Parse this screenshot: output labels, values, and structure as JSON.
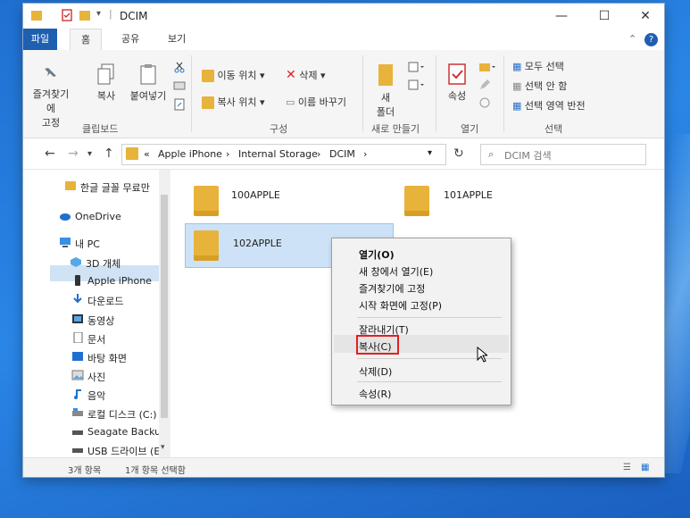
{
  "window": {
    "title": "DCIM",
    "minimize": "—",
    "maximize": "☐",
    "close": "✕"
  },
  "ribbon_tabs": [
    {
      "label": "파일"
    },
    {
      "label": "홈"
    },
    {
      "label": "공유"
    },
    {
      "label": "보기"
    }
  ],
  "ribbon": {
    "clipboard": {
      "pin_line1": "즐겨찾기에",
      "pin_line2": "고정",
      "copy": "복사",
      "paste": "붙여넣기",
      "group": "클립보드"
    },
    "organize": {
      "move_to": "이동 위치",
      "copy_to": "복사 위치",
      "delete": "삭제",
      "rename": "이름 바꾸기",
      "group": "구성"
    },
    "new": {
      "new_folder_line1": "새",
      "new_folder_line2": "폴더",
      "group": "새로 만들기"
    },
    "open": {
      "properties": "속성",
      "group": "열기"
    },
    "select": {
      "select_all": "모두 선택",
      "select_none": "선택 안 함",
      "invert": "선택 영역 반전",
      "group": "선택"
    }
  },
  "address": {
    "prefix": "«",
    "crumbs": [
      "Apple iPhone",
      "Internal Storage",
      "DCIM"
    ],
    "separator": "›",
    "search_placeholder": "DCIM 검색"
  },
  "nav_pane": [
    {
      "label": "한글 글꼴 무료만",
      "icon": "folder-icon"
    },
    {
      "label": "OneDrive",
      "icon": "cloud-icon"
    },
    {
      "label": "내 PC",
      "icon": "pc-icon"
    },
    {
      "label": "3D 개체",
      "icon": "cube-icon"
    },
    {
      "label": "Apple iPhone",
      "icon": "phone-icon"
    },
    {
      "label": "다운로드",
      "icon": "download-icon"
    },
    {
      "label": "동영상",
      "icon": "video-icon"
    },
    {
      "label": "문서",
      "icon": "document-icon"
    },
    {
      "label": "바탕 화면",
      "icon": "desktop-icon"
    },
    {
      "label": "사진",
      "icon": "picture-icon"
    },
    {
      "label": "음악",
      "icon": "music-icon"
    },
    {
      "label": "로컬 디스크 (C:)",
      "icon": "disk-icon"
    },
    {
      "label": "Seagate Backup",
      "icon": "drive-icon"
    },
    {
      "label": "USB 드라이브 (E",
      "icon": "usb-icon"
    }
  ],
  "files": [
    {
      "name": "100APPLE"
    },
    {
      "name": "101APPLE"
    },
    {
      "name": "102APPLE"
    }
  ],
  "context_menu": {
    "open": "열기(O)",
    "open_new_window": "새 창에서 열기(E)",
    "pin_quick": "즐겨찾기에 고정",
    "pin_start": "시작 화면에 고정(P)",
    "cut": "잘라내기(T)",
    "copy": "복사(C)",
    "delete": "삭제(D)",
    "properties": "속성(R)"
  },
  "status": {
    "count": "3개 항목",
    "selected": "1개 항목 선택함"
  },
  "colors": {
    "folder": "#e8b33b",
    "accent": "#1f5fb0",
    "highlight_box": "#e02020"
  }
}
